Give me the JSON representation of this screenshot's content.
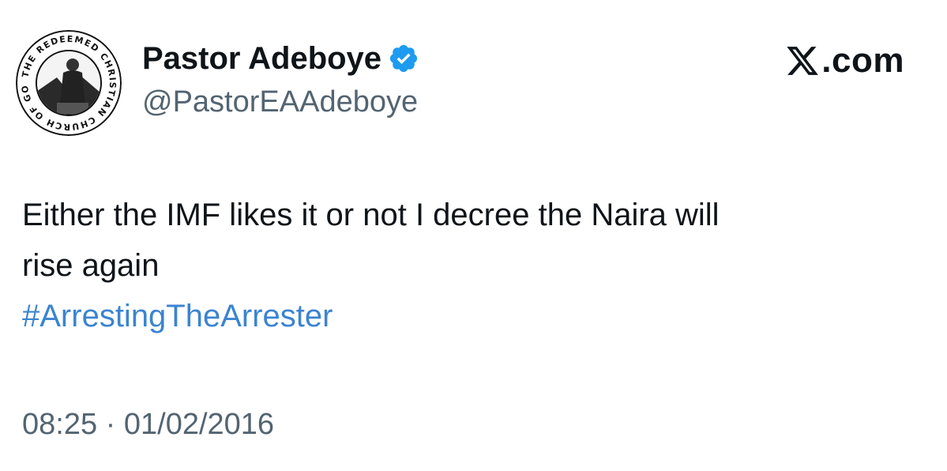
{
  "author": {
    "display_name": "Pastor Adeboye",
    "handle": "@PastorEAAdeboye",
    "verified": true,
    "avatar_icon": "church-logo-avatar-icon",
    "avatar_ring_text": "THE REDEEMED CHRISTIAN CHURCH OF GOD"
  },
  "brand": {
    "icon": "x-logo-icon",
    "label": ".com"
  },
  "tweet": {
    "line_1": "Either the IMF likes it or not I decree the Naira will",
    "line_2": "rise again",
    "hashtag": "#ArrestingTheArrester",
    "time": "08:25",
    "separator": " · ",
    "date": "01/02/2016"
  },
  "colors": {
    "text": "#0f1419",
    "secondary": "#536471",
    "link": "#3b84d0",
    "verified_badge": "#1d9bf0"
  }
}
